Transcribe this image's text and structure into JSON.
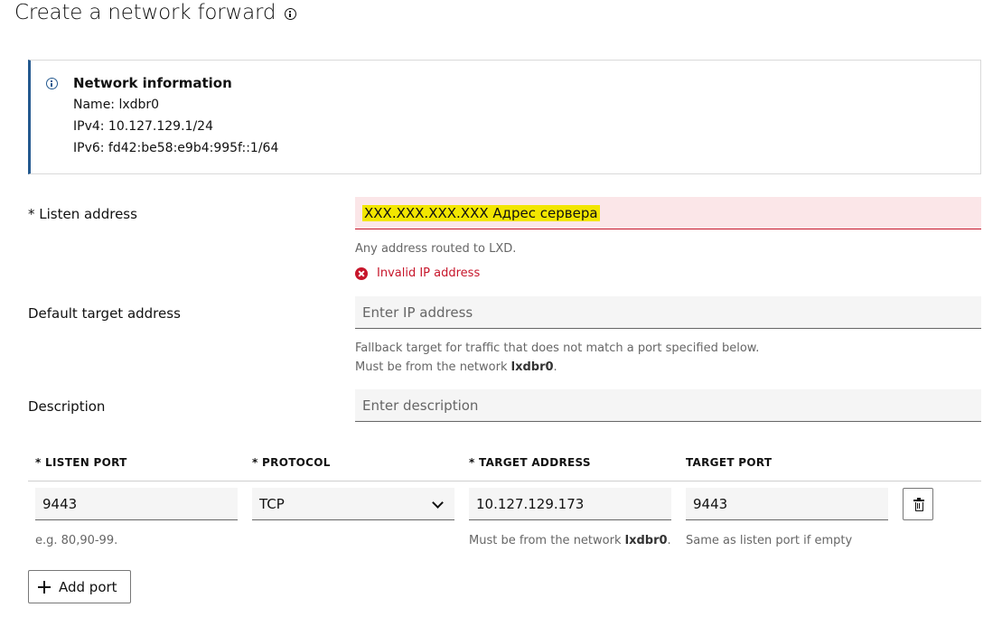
{
  "page": {
    "title": "Create a network forward"
  },
  "network_info": {
    "title": "Network information",
    "name": "Name: lxdbr0",
    "ipv4": "IPv4: 10.127.129.1/24",
    "ipv6": "IPv6: fd42:be58:e9b4:995f::1/64"
  },
  "form": {
    "listen_address": {
      "label": "* Listen address",
      "value": "XXX.XXX.XXX.XXX Адрес сервера",
      "help": "Any address routed to LXD.",
      "error": "Invalid IP address"
    },
    "default_target": {
      "label": "Default target address",
      "placeholder": "Enter IP address",
      "help_line1": "Fallback target for traffic that does not match a port specified below.",
      "help_line2_prefix": "Must be from the network ",
      "help_line2_network": "lxdbr0",
      "help_line2_suffix": "."
    },
    "description": {
      "label": "Description",
      "placeholder": "Enter description"
    }
  },
  "ports_table": {
    "headers": {
      "listen_port": "* LISTEN PORT",
      "protocol": "* PROTOCOL",
      "target_address": "* TARGET ADDRESS",
      "target_port": "TARGET PORT"
    },
    "row": {
      "listen_port": "9443",
      "protocol": "TCP",
      "target_address": "10.127.129.173",
      "target_port": "9443"
    },
    "help": {
      "listen_port": "e.g. 80,90-99.",
      "target_address_prefix": "Must be from the network ",
      "target_address_network": "lxdbr0",
      "target_address_suffix": ".",
      "target_port": "Same as listen port if empty"
    }
  },
  "actions": {
    "add_port": "Add port"
  },
  "colors": {
    "accent": "#24598f",
    "error": "#c7162b",
    "error_bg": "#fbe6e8",
    "highlight": "#f2e600",
    "input_bg": "#f5f5f5"
  },
  "icons": [
    "info-icon",
    "error-icon",
    "chevron-down-icon",
    "trash-icon",
    "plus-icon"
  ]
}
